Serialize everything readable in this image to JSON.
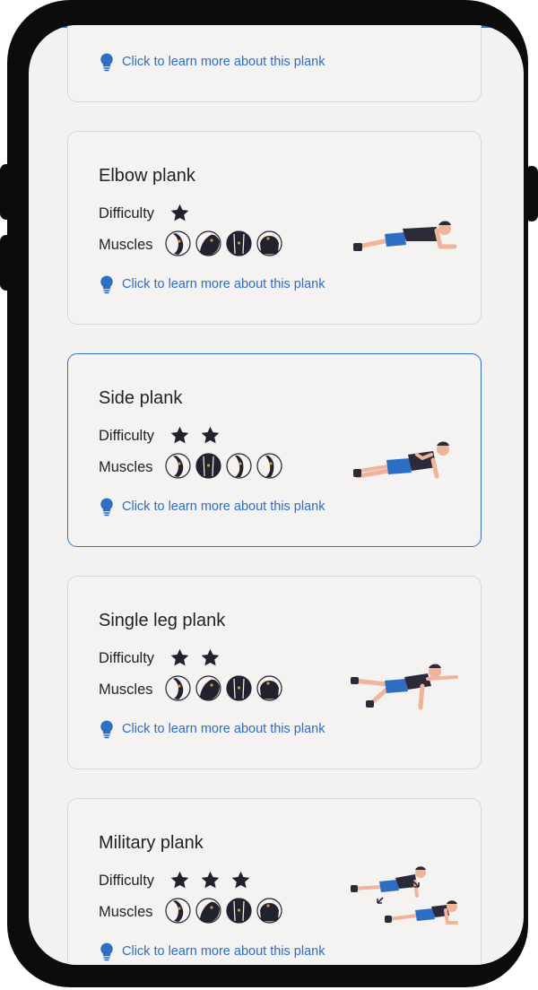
{
  "colors": {
    "accent": "#2e6ec2",
    "card_background": "#f4f3f2",
    "screen_background": "#f3f2f1",
    "star": "#22222e",
    "bezel": "#0c0c0c"
  },
  "labels": {
    "difficulty": "Difficulty",
    "muscles": "Muscles",
    "learn_more": "Click to learn more about this plank"
  },
  "icons": {
    "difficulty_star": "star-icon",
    "muscle_group": "muscle-icon",
    "learn_more": "lightbulb-icon"
  },
  "partial_card": {
    "learn_more": "Click to learn more about this plank"
  },
  "planks": [
    {
      "title": "Elbow plank",
      "difficulty": 1,
      "muscle_icons": [
        "arm-muscle",
        "shoulder-muscle",
        "chest-muscle",
        "back-muscle"
      ],
      "figure": "elbow-plank-figure",
      "selected": false
    },
    {
      "title": "Side plank",
      "difficulty": 2,
      "muscle_icons": [
        "arm-muscle",
        "chest-muscle",
        "leg-muscle",
        "leg-muscle"
      ],
      "figure": "side-plank-figure",
      "selected": true
    },
    {
      "title": "Single leg plank",
      "difficulty": 2,
      "muscle_icons": [
        "arm-muscle",
        "shoulder-muscle",
        "chest-muscle",
        "back-muscle"
      ],
      "figure": "single-leg-plank-figure",
      "selected": false
    },
    {
      "title": "Military plank",
      "difficulty": 3,
      "muscle_icons": [
        "arm-muscle",
        "shoulder-muscle",
        "chest-muscle",
        "back-muscle"
      ],
      "figure": "military-plank-figure",
      "selected": false
    }
  ]
}
